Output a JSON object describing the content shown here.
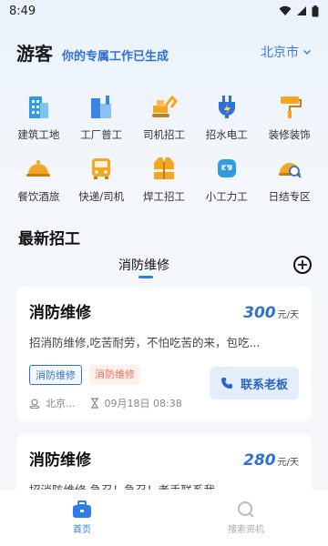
{
  "status": {
    "time": "8:49"
  },
  "header": {
    "user": "游客",
    "tagline": "你的专属工作已生成",
    "city": "北京市"
  },
  "categories": [
    {
      "label": "建筑工地",
      "icon": "building-icon",
      "color": "#2f9be0"
    },
    {
      "label": "工厂普工",
      "icon": "factory-icon",
      "color": "#3a86e8"
    },
    {
      "label": "司机招工",
      "icon": "excavator-icon",
      "color": "#f4a524"
    },
    {
      "label": "招水电工",
      "icon": "plug-icon",
      "color": "#2f6fd6"
    },
    {
      "label": "装修装饰",
      "icon": "paint-roller-icon",
      "color": "#f4a524"
    },
    {
      "label": "餐饮酒旅",
      "icon": "food-cloche-icon",
      "color": "#f4a524"
    },
    {
      "label": "快递/司机",
      "icon": "bus-icon",
      "color": "#f4a524"
    },
    {
      "label": "焊工招工",
      "icon": "vest-icon",
      "color": "#f4a524"
    },
    {
      "label": "小工力工",
      "icon": "welding-mask-icon",
      "color": "#2f9be0"
    },
    {
      "label": "日结专区",
      "icon": "helmet-icon",
      "color": "#f4a524"
    }
  ],
  "section_title": "最新招工",
  "tab": {
    "active_label": "消防维修"
  },
  "jobs": [
    {
      "title": "消防维修",
      "wage": "300",
      "wage_unit": "元/天",
      "desc": "招消防维修,吃苦耐劳，不怕吃苦的来，包吃...",
      "tag1": "消防维修",
      "tag2": "消防维修",
      "location": "北京...",
      "date": "09月18日 08:38",
      "contact_label": "联系老板"
    },
    {
      "title": "消防维修",
      "wage": "280",
      "wage_unit": "元/天",
      "desc": "招消防维修,急召！急召！老手联系我"
    }
  ],
  "nav": {
    "home_label": "首页",
    "search_label": "搜索资机"
  }
}
